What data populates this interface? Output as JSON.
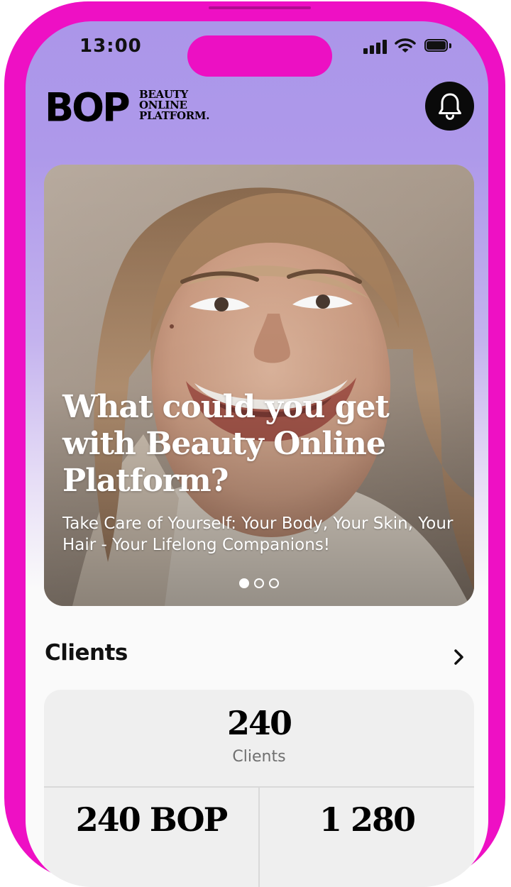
{
  "status_bar": {
    "time": "13:00"
  },
  "brand": {
    "logo_mark": "BOP",
    "logo_sub_lines": [
      "BEAUTY",
      "ONLINE",
      "PLATFORM."
    ]
  },
  "header": {
    "notification_icon": "bell-icon"
  },
  "hero": {
    "title": "What could you get with Beauty Online Platform?",
    "subtitle": "Take Care of Yourself: Your Body, Your Skin, Your Hair - Your Lifelong Companions!",
    "carousel": {
      "slides": 3,
      "active_index": 0
    }
  },
  "clients_section": {
    "title": "Clients",
    "arrow_icon": "chevron-right-icon",
    "main_stat": {
      "value": "240",
      "label": "Clients"
    },
    "left_stat": {
      "value": "240 BOP"
    },
    "right_stat": {
      "value": "1 280"
    }
  },
  "colors": {
    "device_frame": "#ee10c4",
    "header_gradient_top": "#ab96e9",
    "screen_background": "#fafafa",
    "stats_card": "#efefef",
    "text_primary": "#111111",
    "text_secondary": "#6f6f6f"
  }
}
